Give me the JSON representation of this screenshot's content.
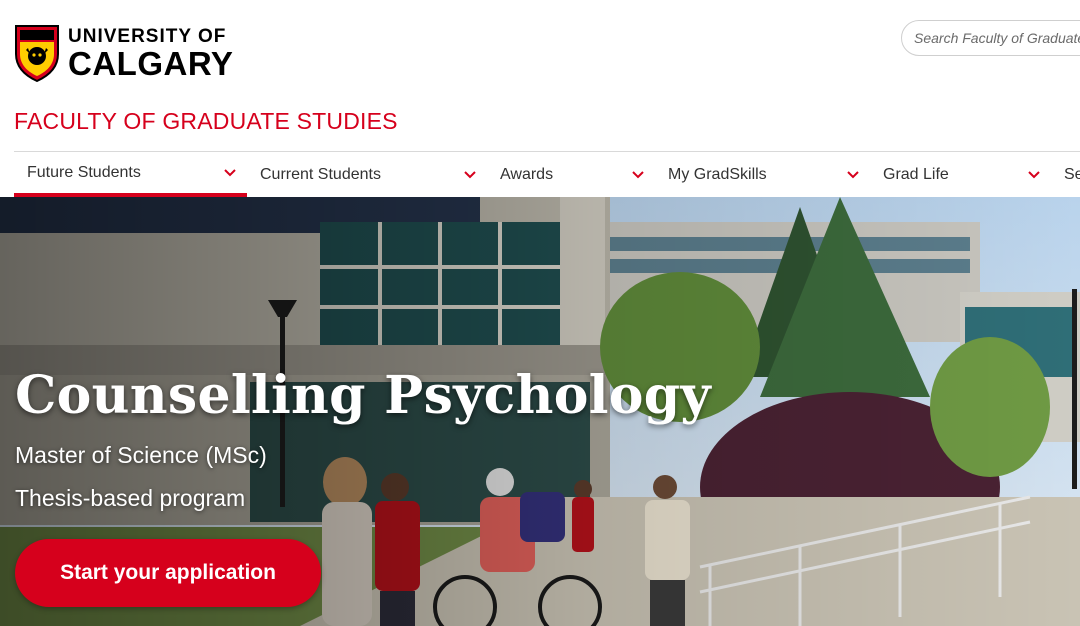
{
  "header": {
    "logo_line1": "UNIVERSITY OF",
    "logo_line2": "CALGARY",
    "search_placeholder": "Search Faculty of Graduate Studies",
    "faculty_title": "FACULTY OF GRADUATE STUDIES"
  },
  "nav": {
    "items": [
      {
        "label": "Future Students"
      },
      {
        "label": "Current Students"
      },
      {
        "label": "Awards"
      },
      {
        "label": "My GradSkills"
      },
      {
        "label": "Grad Life"
      },
      {
        "label": "Se"
      }
    ],
    "active_index": 0
  },
  "hero": {
    "title": "Counselling Psychology",
    "degree": "Master of Science (MSc)",
    "program_type": "Thesis-based program",
    "cta_label": "Start your application"
  },
  "colors": {
    "brand_red": "#d6001c",
    "nav_text": "#333333"
  },
  "icons": {
    "logo": "university-crest-icon",
    "nav_chevron": "chevron-down-icon"
  }
}
